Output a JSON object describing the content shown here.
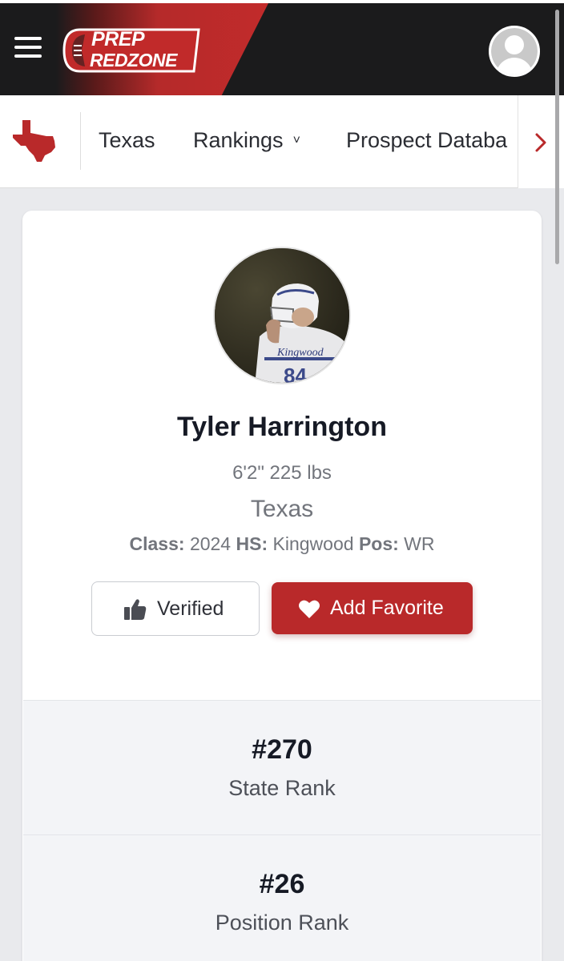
{
  "header": {
    "logo_line1": "PREP",
    "logo_line2": "REDZONE",
    "menu_icon": "hamburger-menu-icon",
    "avatar_icon": "user-avatar-icon"
  },
  "subnav": {
    "state_icon": "texas-map-icon",
    "items": [
      {
        "label": "Texas"
      },
      {
        "label": "Rankings",
        "chevron": "˅"
      },
      {
        "label": "Prospect Databa"
      }
    ],
    "scroll_icon": "chevron-right-icon"
  },
  "profile": {
    "name": "Tyler Harrington",
    "measurements": "6'2\" 225 lbs",
    "state": "Texas",
    "class_label": "Class:",
    "class_value": "2024",
    "hs_label": "HS:",
    "hs_value": "Kingwood",
    "pos_label": "Pos:",
    "pos_value": "WR",
    "photo_jersey_text": "Kingwood",
    "photo_number_text": "84"
  },
  "actions": {
    "verified_label": "Verified",
    "favorite_label": "Add Favorite"
  },
  "ranks": [
    {
      "value": "#270",
      "label": "State Rank"
    },
    {
      "value": "#26",
      "label": "Position Rank"
    }
  ],
  "colors": {
    "header_bg": "#1b1b1c",
    "brand_red": "#b9292a",
    "text_dark": "#161a25",
    "text_muted": "#72757c",
    "page_bg": "#e9eaed"
  }
}
